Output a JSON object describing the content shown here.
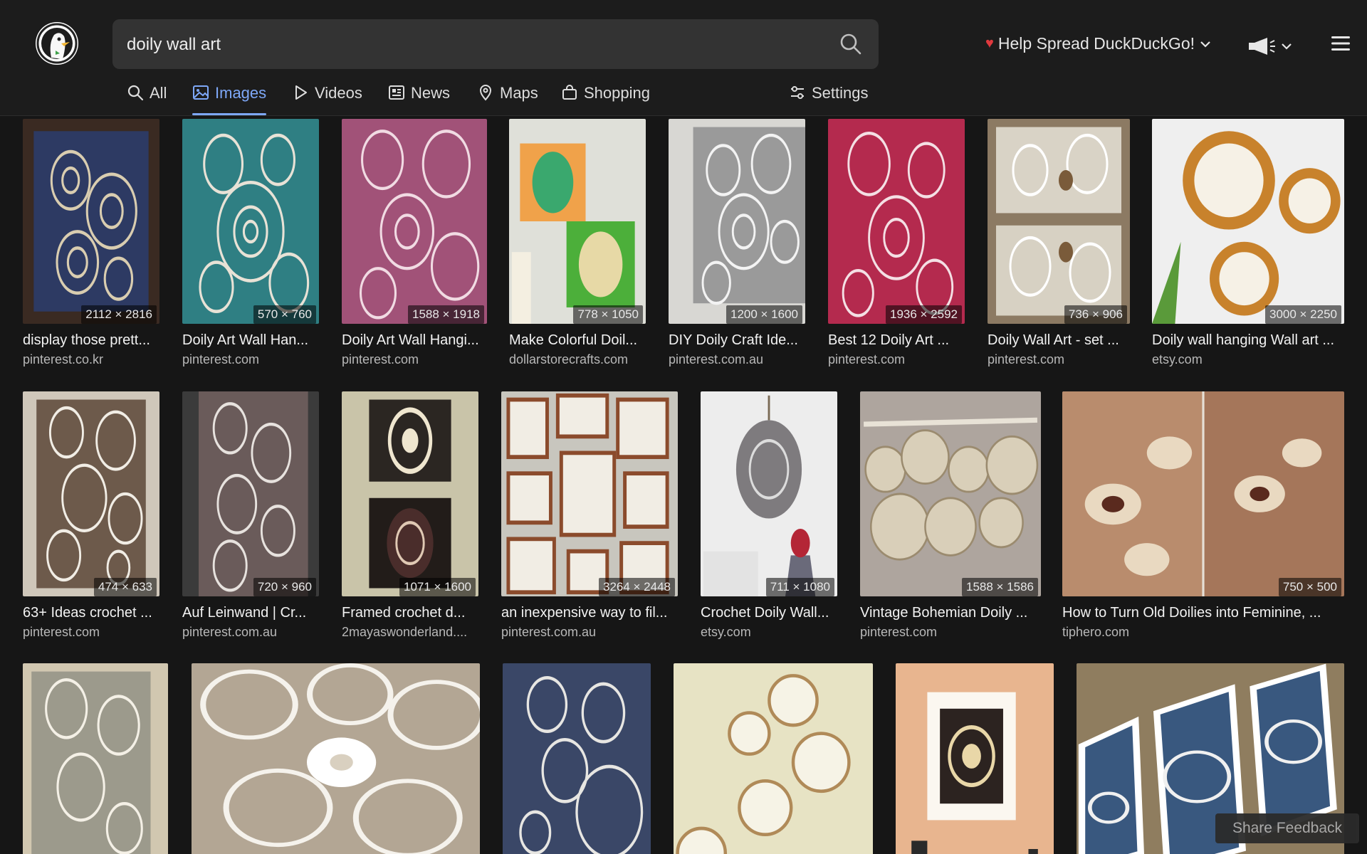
{
  "search": {
    "query": "doily wall art"
  },
  "header": {
    "promo_label": "Help Spread DuckDuckGo!",
    "accent": "#7ea8f8",
    "heart_color": "#e0393e"
  },
  "tabs": [
    {
      "label": "All",
      "icon": "search-icon"
    },
    {
      "label": "Images",
      "icon": "image-icon",
      "active": true
    },
    {
      "label": "Videos",
      "icon": "play-icon"
    },
    {
      "label": "News",
      "icon": "news-icon"
    },
    {
      "label": "Maps",
      "icon": "map-pin-icon"
    },
    {
      "label": "Shopping",
      "icon": "shopping-bag-icon"
    },
    {
      "label": "Settings",
      "icon": "sliders-icon"
    }
  ],
  "results": [
    {
      "title": "display those prett...",
      "source": "pinterest.co.kr",
      "dims": "2112 × 2816",
      "bg": "#2d3a63"
    },
    {
      "title": "Doily Art Wall Han...",
      "source": "pinterest.com",
      "dims": "570 × 760",
      "bg": "#2f7f83"
    },
    {
      "title": "Doily Art Wall Hangi...",
      "source": "pinterest.com",
      "dims": "1588 × 1918",
      "bg": "#a15278"
    },
    {
      "title": "Make Colorful Doil...",
      "source": "dollarstorecrafts.com",
      "dims": "778 × 1050",
      "bg": "#dfe0d9"
    },
    {
      "title": "DIY Doily Craft Ide...",
      "source": "pinterest.com.au",
      "dims": "1200 × 1600",
      "bg": "#9a9a9a"
    },
    {
      "title": "Best 12 Doily Art ...",
      "source": "pinterest.com",
      "dims": "1936 × 2592",
      "bg": "#b42a4e"
    },
    {
      "title": "Doily Wall Art - set ...",
      "source": "pinterest.com",
      "dims": "736 × 906",
      "bg": "#8c7a63"
    },
    {
      "title": "Doily wall hanging Wall art ...",
      "source": "etsy.com",
      "dims": "3000 × 2250",
      "bg": "#efefef"
    },
    {
      "title": "63+ Ideas crochet ...",
      "source": "pinterest.com",
      "dims": "474 × 633",
      "bg": "#6d5a4b"
    },
    {
      "title": "Auf Leinwand | Cr...",
      "source": "pinterest.com.au",
      "dims": "720 × 960",
      "bg": "#6a5b5a"
    },
    {
      "title": "Framed crochet d...",
      "source": "2mayaswonderland....",
      "dims": "1071 × 1600",
      "bg": "#c9c4a9"
    },
    {
      "title": "an inexpensive way to fil...",
      "source": "pinterest.com.au",
      "dims": "3264 × 2448",
      "bg": "#c8c6be"
    },
    {
      "title": "Crochet Doily Wall...",
      "source": "etsy.com",
      "dims": "711 × 1080",
      "bg": "#ededed"
    },
    {
      "title": "Vintage Bohemian Doily ...",
      "source": "pinterest.com",
      "dims": "1588 × 1586",
      "bg": "#aea59e"
    },
    {
      "title": "How to Turn Old Doilies into Feminine, ...",
      "source": "tiphero.com",
      "dims": "750 × 500",
      "bg": "#a5765a"
    },
    {
      "title": "",
      "source": "",
      "dims": "",
      "bg": "#d1c7b0"
    },
    {
      "title": "",
      "source": "",
      "dims": "",
      "bg": "#b3a694"
    },
    {
      "title": "",
      "source": "",
      "dims": "",
      "bg": "#3a4767"
    },
    {
      "title": "",
      "source": "",
      "dims": "",
      "bg": "#e7e3c4"
    },
    {
      "title": "",
      "source": "",
      "dims": "",
      "bg": "#e8b58f"
    },
    {
      "title": "",
      "source": "",
      "dims": "",
      "bg": "#8f7d5f"
    }
  ],
  "feedback": {
    "label": "Share Feedback"
  }
}
